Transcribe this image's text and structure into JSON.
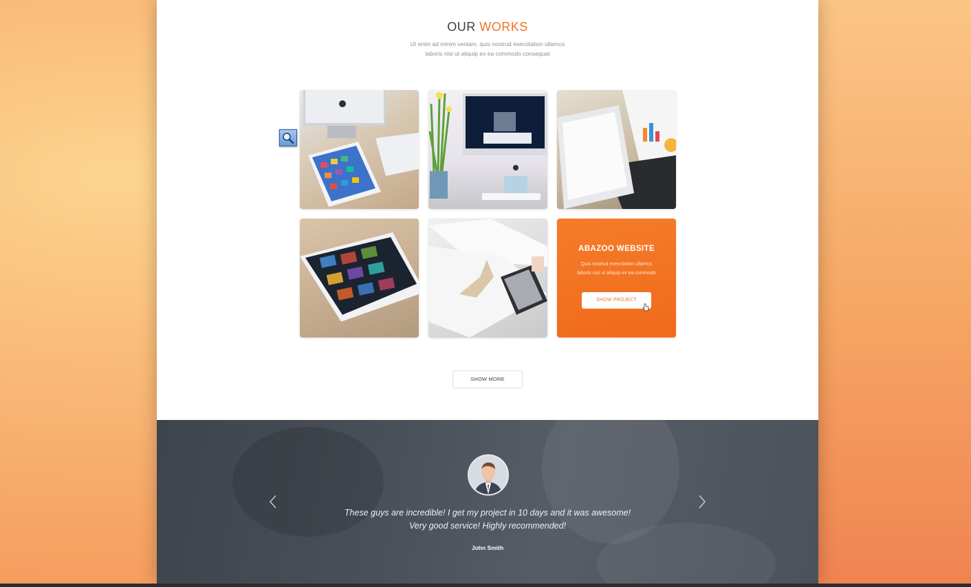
{
  "works": {
    "title_part1": "OUR",
    "title_part2": "WORKS",
    "subtitle_line1": "Ut enim ad minim veniam, quis nostrud exercitation ullamco",
    "subtitle_line2": "laboris nisi ut aliquip ex ea commodo consequat",
    "hover_card": {
      "title": "ABAZOO WEBSITE",
      "text_line1": "Quis nostrud exercitation ullamco",
      "text_line2": "laboris nisi ut aliquip ex ea commodo",
      "button": "SHOW PROJECT"
    },
    "show_more": "SHOW MORE"
  },
  "testimonial": {
    "quote_line1": "These guys are incredible! I get my project in 10 days and it was awesome!",
    "quote_line2": "Very good service! Highly recommended!",
    "author": "John Smith"
  },
  "colors": {
    "accent": "#f07325",
    "heading": "#3a3f47",
    "testimonial_bg": "#4a5059"
  },
  "icons": [
    "zoom-tool-icon",
    "cursor-icon",
    "chevron-left-icon",
    "chevron-right-icon"
  ]
}
